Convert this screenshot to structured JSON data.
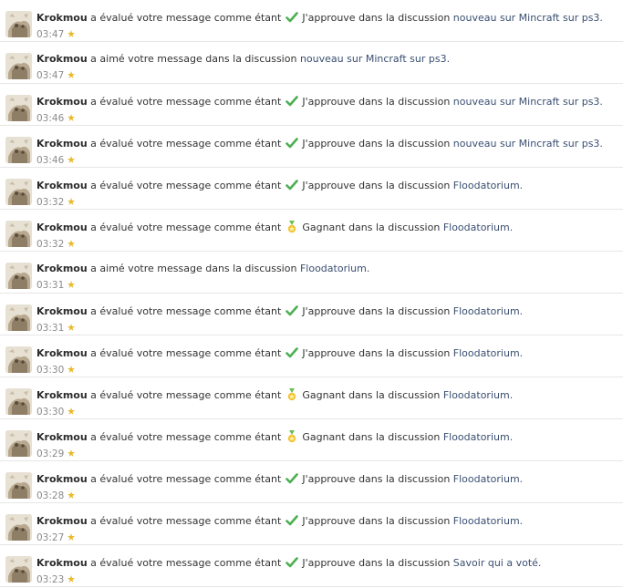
{
  "colors": {
    "link": "#3a4f71",
    "user": "#2b2b2b",
    "time": "#8b8b8b",
    "separator": "#e6e6e6",
    "check_green": "#4caf50",
    "medal_gold": "#f2c230",
    "medal_green": "#6cbf4f"
  },
  "items": [
    {
      "user": "Krokmou",
      "text": "a évalué votre message comme étant",
      "rating_icon": "check-icon",
      "rating": "J'approuve",
      "in": "dans la discussion",
      "thread": "nouveau sur Mincraft sur ps3.",
      "time": "03:47"
    },
    {
      "user": "Krokmou",
      "text": "a aimé votre message dans la discussion",
      "rating_icon": "",
      "rating": "",
      "in": "",
      "thread": "nouveau sur Mincraft sur ps3.",
      "time": "03:47"
    },
    {
      "user": "Krokmou",
      "text": "a évalué votre message comme étant",
      "rating_icon": "check-icon",
      "rating": "J'approuve",
      "in": "dans la discussion",
      "thread": "nouveau sur Mincraft sur ps3.",
      "time": "03:46"
    },
    {
      "user": "Krokmou",
      "text": "a évalué votre message comme étant",
      "rating_icon": "check-icon",
      "rating": "J'approuve",
      "in": "dans la discussion",
      "thread": "nouveau sur Mincraft sur ps3.",
      "time": "03:46"
    },
    {
      "user": "Krokmou",
      "text": "a évalué votre message comme étant",
      "rating_icon": "check-icon",
      "rating": "J'approuve",
      "in": "dans la discussion",
      "thread": "Floodatorium.",
      "time": "03:32"
    },
    {
      "user": "Krokmou",
      "text": "a évalué votre message comme étant",
      "rating_icon": "medal-icon",
      "rating": "Gagnant",
      "in": "dans la discussion",
      "thread": "Floodatorium.",
      "time": "03:32"
    },
    {
      "user": "Krokmou",
      "text": "a aimé votre message dans la discussion",
      "rating_icon": "",
      "rating": "",
      "in": "",
      "thread": "Floodatorium.",
      "time": "03:31"
    },
    {
      "user": "Krokmou",
      "text": "a évalué votre message comme étant",
      "rating_icon": "check-icon",
      "rating": "J'approuve",
      "in": "dans la discussion",
      "thread": "Floodatorium.",
      "time": "03:31"
    },
    {
      "user": "Krokmou",
      "text": "a évalué votre message comme étant",
      "rating_icon": "check-icon",
      "rating": "J'approuve",
      "in": "dans la discussion",
      "thread": "Floodatorium.",
      "time": "03:30"
    },
    {
      "user": "Krokmou",
      "text": "a évalué votre message comme étant",
      "rating_icon": "medal-icon",
      "rating": "Gagnant",
      "in": "dans la discussion",
      "thread": "Floodatorium.",
      "time": "03:30"
    },
    {
      "user": "Krokmou",
      "text": "a évalué votre message comme étant",
      "rating_icon": "medal-icon",
      "rating": "Gagnant",
      "in": "dans la discussion",
      "thread": "Floodatorium.",
      "time": "03:29"
    },
    {
      "user": "Krokmou",
      "text": "a évalué votre message comme étant",
      "rating_icon": "check-icon",
      "rating": "J'approuve",
      "in": "dans la discussion",
      "thread": "Floodatorium.",
      "time": "03:28"
    },
    {
      "user": "Krokmou",
      "text": "a évalué votre message comme étant",
      "rating_icon": "check-icon",
      "rating": "J'approuve",
      "in": "dans la discussion",
      "thread": "Floodatorium.",
      "time": "03:27"
    },
    {
      "user": "Krokmou",
      "text": "a évalué votre message comme étant",
      "rating_icon": "check-icon",
      "rating": "J'approuve",
      "in": "dans la discussion",
      "thread": "Savoir qui a voté.",
      "time": "03:23"
    }
  ]
}
